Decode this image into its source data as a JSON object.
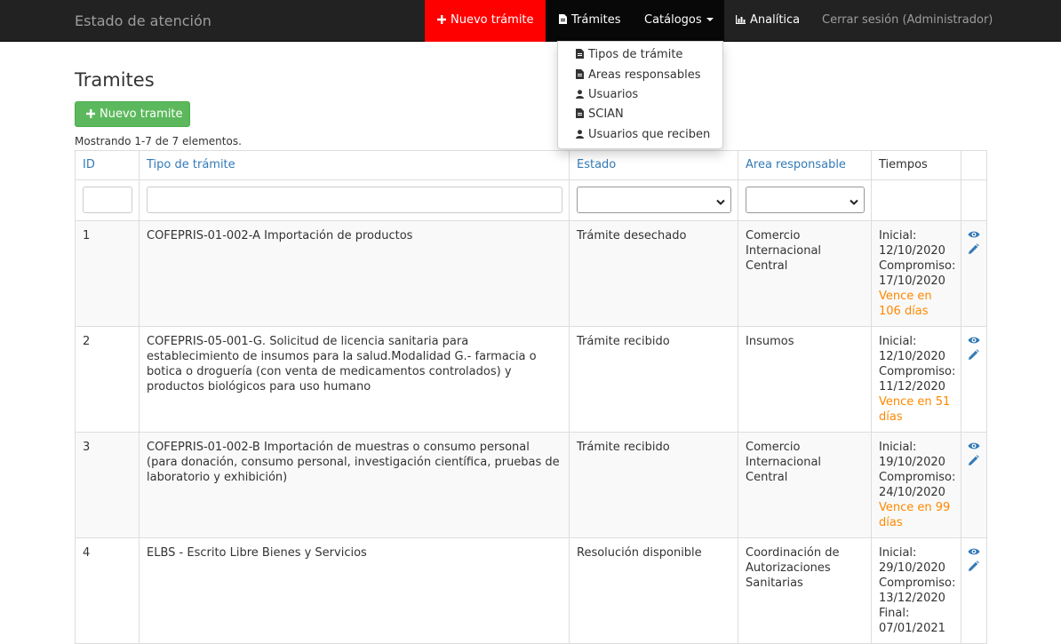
{
  "nav": {
    "brand": "Estado de atención",
    "new_tramite": "Nuevo trámite",
    "tramites": "Trámites",
    "catalogos": "Catálogos",
    "analitica": "Analítica",
    "logout": "Cerrar sesión (Administrador)"
  },
  "dropdown": {
    "items": [
      {
        "label": "Tipos de trámite",
        "icon": "file-icon"
      },
      {
        "label": "Areas responsables",
        "icon": "file-icon"
      },
      {
        "label": "Usuarios",
        "icon": "user-icon"
      },
      {
        "label": "SCIAN",
        "icon": "file-icon"
      },
      {
        "label": "Usuarios que reciben",
        "icon": "user-icon"
      }
    ]
  },
  "page": {
    "title": "Tramites",
    "new_button": "Nuevo tramite",
    "summary": "Mostrando 1-7 de 7 elementos."
  },
  "table": {
    "headers": {
      "id": "ID",
      "tipo": "Tipo de trámite",
      "estado": "Estado",
      "area": "Area responsable",
      "tiempos": "Tiempos"
    },
    "rows": [
      {
        "id": "1",
        "tipo": "COFEPRIS-01-002-A Importación de productos",
        "estado": "Trámite desechado",
        "area": "Comercio Internacional Central",
        "inicial_label": "Inicial:",
        "inicial": "12/10/2020",
        "compromiso_label": "Compromiso:",
        "compromiso": "17/10/2020",
        "vence": "Vence en 106 días"
      },
      {
        "id": "2",
        "tipo": "COFEPRIS-05-001-G. Solicitud de licencia sanitaria para establecimiento de insumos para la salud.Modalidad G.- farmacia o botica o droguería (con venta de medicamentos controlados) y productos biológicos para uso humano",
        "estado": "Trámite recibido",
        "area": "Insumos",
        "inicial_label": "Inicial:",
        "inicial": "12/10/2020",
        "compromiso_label": "Compromiso:",
        "compromiso": "11/12/2020",
        "vence": "Vence en 51 días"
      },
      {
        "id": "3",
        "tipo": "COFEPRIS-01-002-B Importación de muestras o consumo personal (para donación, consumo personal, investigación científica, pruebas de laboratorio y exhibición)",
        "estado": "Trámite recibido",
        "area": "Comercio Internacional Central",
        "inicial_label": "Inicial:",
        "inicial": "19/10/2020",
        "compromiso_label": "Compromiso:",
        "compromiso": "24/10/2020",
        "vence": "Vence en 99 días"
      },
      {
        "id": "4",
        "tipo": "ELBS - Escrito Libre Bienes y Servicios",
        "estado": "Resolución disponible",
        "area": "Coordinación de Autorizaciones Sanitarias",
        "inicial_label": "Inicial:",
        "inicial": "29/10/2020",
        "compromiso_label": "Compromiso:",
        "compromiso": "13/12/2020",
        "final_label": "Final:",
        "final": "07/01/2021"
      }
    ]
  },
  "colors": {
    "navbar": "#222222",
    "new_tramite_bg": "#ff0000",
    "success_button": "#5cb85c",
    "link": "#337ab7",
    "warning_text": "#ff8800"
  }
}
